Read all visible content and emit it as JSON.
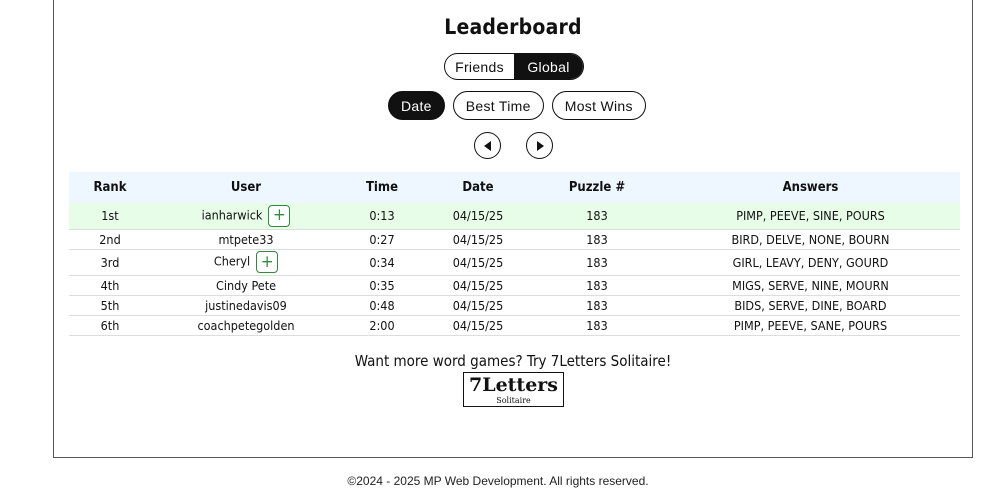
{
  "title": "Leaderboard",
  "scope_tabs": [
    {
      "label": "Friends",
      "active": false
    },
    {
      "label": "Global",
      "active": true
    }
  ],
  "sort_tabs": [
    {
      "label": "Date",
      "active": true
    },
    {
      "label": "Best Time",
      "active": false
    },
    {
      "label": "Most Wins",
      "active": false
    }
  ],
  "nav": {
    "prev_icon": "triangle-left-icon",
    "next_icon": "triangle-right-icon"
  },
  "table": {
    "headers": [
      "Rank",
      "User",
      "Time",
      "Date",
      "Puzzle #",
      "Answers"
    ],
    "rows": [
      {
        "rank": "1st",
        "user": "ianharwick",
        "time": "0:13",
        "date": "04/15/25",
        "puzzle": "183",
        "answers": "PIMP, PEEVE, SINE, POURS",
        "add_friend": true,
        "highlight": true
      },
      {
        "rank": "2nd",
        "user": "mtpete33",
        "time": "0:27",
        "date": "04/15/25",
        "puzzle": "183",
        "answers": "BIRD, DELVE, NONE, BOURN",
        "add_friend": false,
        "highlight": false
      },
      {
        "rank": "3rd",
        "user": "Cheryl",
        "time": "0:34",
        "date": "04/15/25",
        "puzzle": "183",
        "answers": "GIRL, LEAVY, DENY, GOURD",
        "add_friend": true,
        "highlight": false
      },
      {
        "rank": "4th",
        "user": "Cindy Pete",
        "time": "0:35",
        "date": "04/15/25",
        "puzzle": "183",
        "answers": "MIGS, SERVE, NINE, MOURN",
        "add_friend": false,
        "highlight": false
      },
      {
        "rank": "5th",
        "user": "justinedavis09",
        "time": "0:48",
        "date": "04/15/25",
        "puzzle": "183",
        "answers": "BIDS, SERVE, DINE, BOARD",
        "add_friend": false,
        "highlight": false
      },
      {
        "rank": "6th",
        "user": "coachpetegolden",
        "time": "2:00",
        "date": "04/15/25",
        "puzzle": "183",
        "answers": "PIMP, PEEVE, SANE, POURS",
        "add_friend": false,
        "highlight": false
      }
    ],
    "add_label": "+"
  },
  "promo": {
    "text": "Want more word games? Try 7Letters Solitaire!",
    "logo_main": "7Letters",
    "logo_sub": "Solitaire"
  },
  "footer": "©2024 - 2025 MP Web Development. All rights reserved.",
  "colors": {
    "accent": "#111111",
    "highlight_row": "#e8fde8",
    "header_bg": "#eef6ff",
    "add_green": "#2e8b3e"
  }
}
